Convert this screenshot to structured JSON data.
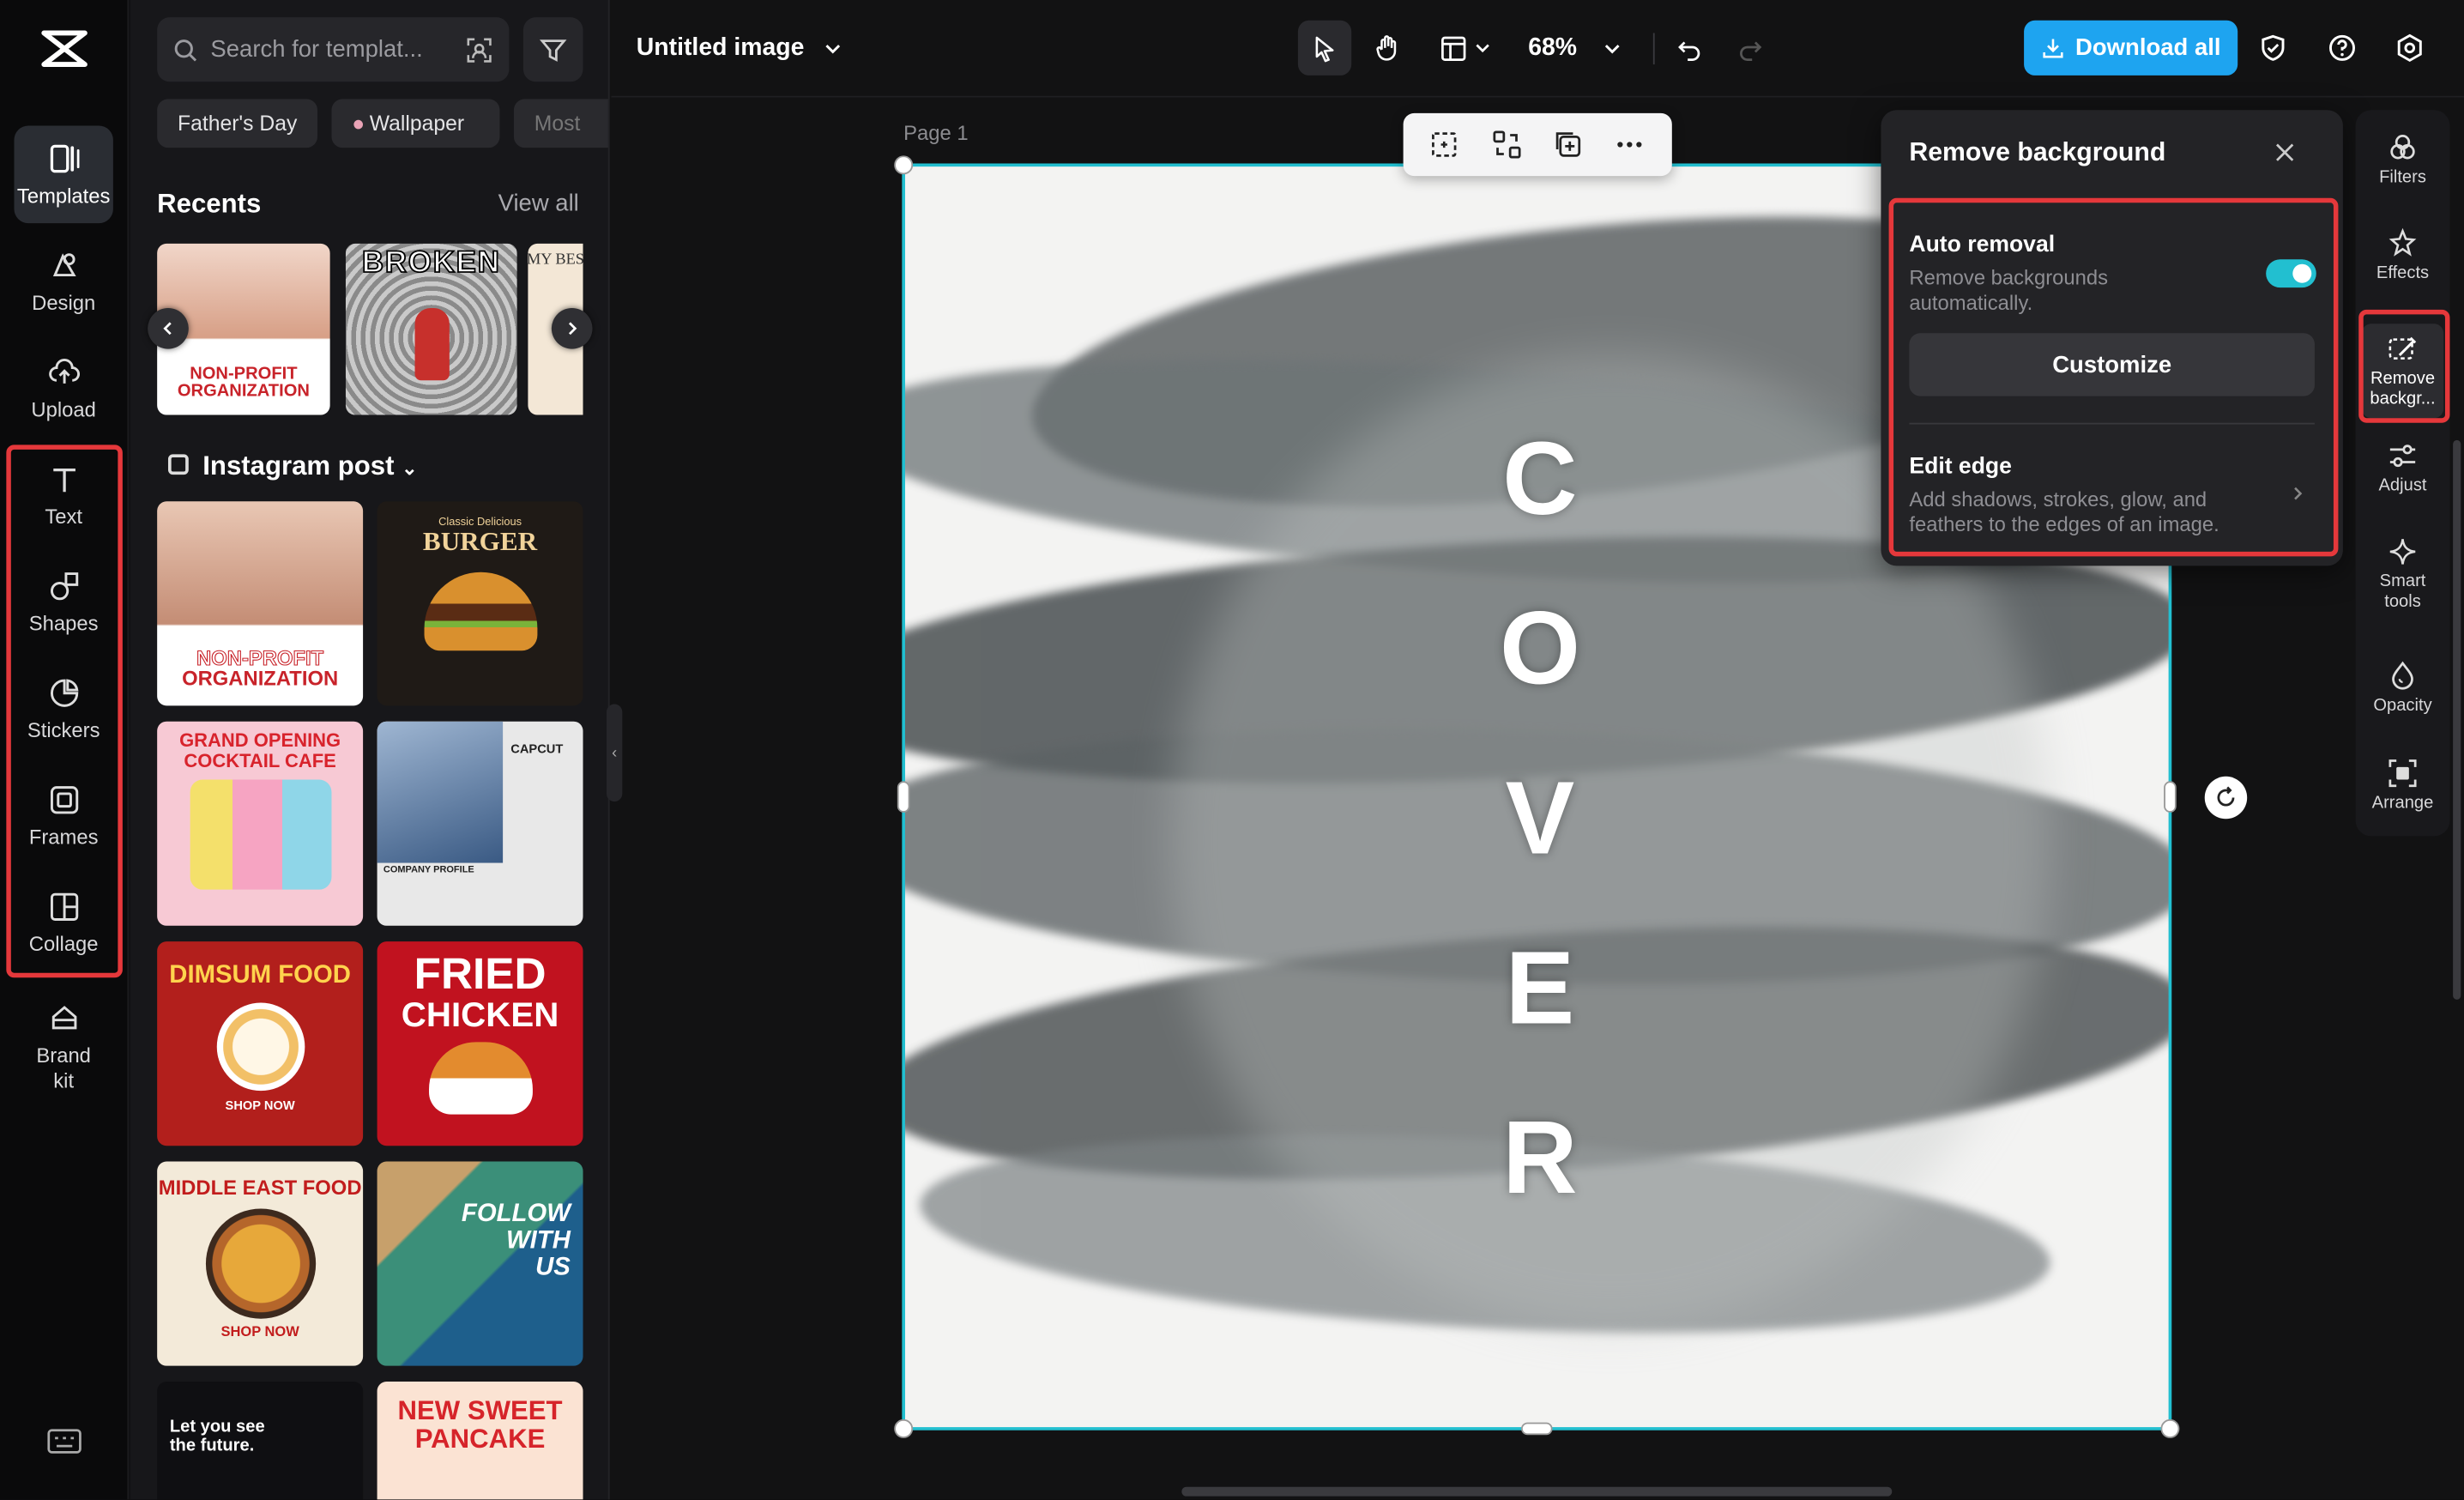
{
  "app": {
    "doc_title": "Untitled image",
    "zoom": "68%",
    "download_label": "Download all",
    "page_label": "Page 1"
  },
  "nav": {
    "items": [
      {
        "label": "Templates",
        "icon": "templates-icon"
      },
      {
        "label": "Design",
        "icon": "design-icon"
      },
      {
        "label": "Upload",
        "icon": "upload-icon"
      },
      {
        "label": "Text",
        "icon": "text-icon"
      },
      {
        "label": "Shapes",
        "icon": "shapes-icon"
      },
      {
        "label": "Stickers",
        "icon": "stickers-icon"
      },
      {
        "label": "Frames",
        "icon": "frames-icon"
      },
      {
        "label": "Collage",
        "icon": "collage-icon"
      },
      {
        "label": "Brand kit",
        "icon": "brand-kit-icon"
      }
    ]
  },
  "panel": {
    "search_placeholder": "Search for templat...",
    "chips": [
      "Father's Day",
      "Wallpaper",
      "Most"
    ],
    "recents_title": "Recents",
    "view_all": "View all",
    "category": "Instagram post",
    "recent_thumbs": [
      {
        "line1": "NON-PROFIT",
        "line2": "ORGANIZATION"
      },
      {
        "line1": "BROKEN",
        "line2": ""
      },
      {
        "line1": "MY BES",
        "line2": ""
      }
    ],
    "templates": [
      {
        "line1": "NON-PROFIT",
        "line2": "ORGANIZATION",
        "bg": "#ffffff",
        "fg": "#c8232a"
      },
      {
        "line1": "Classic Delicious",
        "line2": "BURGER",
        "bg": "#1f1a16",
        "fg": "#f1d39a"
      },
      {
        "line1": "GRAND OPENING",
        "line2": "COCKTAIL CAFE",
        "bg": "#f7c9d4",
        "fg": "#d8232c"
      },
      {
        "line1": "CAPCUT",
        "line2": "COMPANY PROFILE",
        "bg": "#e8e8e8",
        "fg": "#222222"
      },
      {
        "line1": "DIMSUM FOOD",
        "line2": "SHOP NOW",
        "bg": "#b21f1c",
        "fg": "#ffd34d"
      },
      {
        "line1": "FRIED",
        "line2": "CHICKEN",
        "bg": "#c1121f",
        "fg": "#ffffff"
      },
      {
        "line1": "MIDDLE EAST FOOD",
        "line2": "SHOP NOW",
        "bg": "#f3ead9",
        "fg": "#c21d1d"
      },
      {
        "line1": "FOLLOW WITH",
        "line2": "US",
        "bg": "#2f7f6e",
        "fg": "#ffffff"
      },
      {
        "line1": "Let you see",
        "line2": "the future.",
        "bg": "#0f0f12",
        "fg": "#ffffff"
      },
      {
        "line1": "NEW SWEET",
        "line2": "PANCAKE",
        "bg": "#fbe3d3",
        "fg": "#d6242a"
      }
    ]
  },
  "canvas": {
    "letters": [
      "C",
      "O",
      "V",
      "E",
      "R"
    ]
  },
  "remove_bg": {
    "title": "Remove background",
    "auto_title": "Auto removal",
    "auto_desc": "Remove backgrounds automatically.",
    "auto_enabled": true,
    "customize": "Customize",
    "edge_title": "Edit edge",
    "edge_desc": "Add shadows, strokes, glow, and feathers to the edges of an image."
  },
  "rail": {
    "items": [
      {
        "label": "Filters"
      },
      {
        "label": "Effects"
      },
      {
        "label": "Remove backgr..."
      },
      {
        "label": "Adjust"
      },
      {
        "label": "Smart tools"
      },
      {
        "label": "Opacity"
      },
      {
        "label": "Arrange"
      }
    ]
  },
  "colors": {
    "accent": "#22bfd0",
    "download": "#1ea4f0",
    "highlight": "#e5383b"
  }
}
